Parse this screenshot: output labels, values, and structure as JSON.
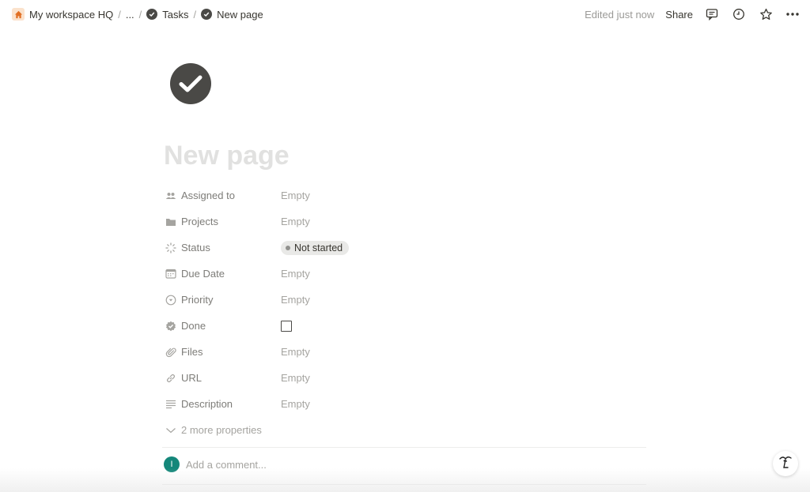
{
  "breadcrumb": {
    "workspace": "My workspace HQ",
    "ellipsis": "...",
    "parent": "Tasks",
    "current": "New page",
    "separator": "/"
  },
  "topbar": {
    "edited": "Edited just now",
    "share": "Share",
    "icons": [
      "comment-icon",
      "history-clock-icon",
      "star-icon",
      "more-icon"
    ]
  },
  "page": {
    "icon": "check-circle-icon",
    "title": "New page"
  },
  "properties": [
    {
      "name": "Assigned to",
      "icon": "people-icon",
      "value": "Empty"
    },
    {
      "name": "Projects",
      "icon": "folder-icon",
      "value": "Empty"
    },
    {
      "name": "Status",
      "icon": "status-spinner-icon",
      "value": "Not started"
    },
    {
      "name": "Due Date",
      "icon": "calendar-icon",
      "value": "Empty"
    },
    {
      "name": "Priority",
      "icon": "select-circle-icon",
      "value": "Empty"
    },
    {
      "name": "Done",
      "icon": "badge-check-icon",
      "value": "unchecked"
    },
    {
      "name": "Files",
      "icon": "paperclip-icon",
      "value": "Empty"
    },
    {
      "name": "URL",
      "icon": "link-icon",
      "value": "Empty"
    },
    {
      "name": "Description",
      "icon": "text-lines-icon",
      "value": "Empty"
    }
  ],
  "more_properties": "2 more properties",
  "comment": {
    "avatar_initial": "I",
    "placeholder": "Add a comment..."
  },
  "colors": {
    "accent_home": "#fbe2cc",
    "avatar": "#14877a",
    "status_pill": "#e9e9e7"
  }
}
